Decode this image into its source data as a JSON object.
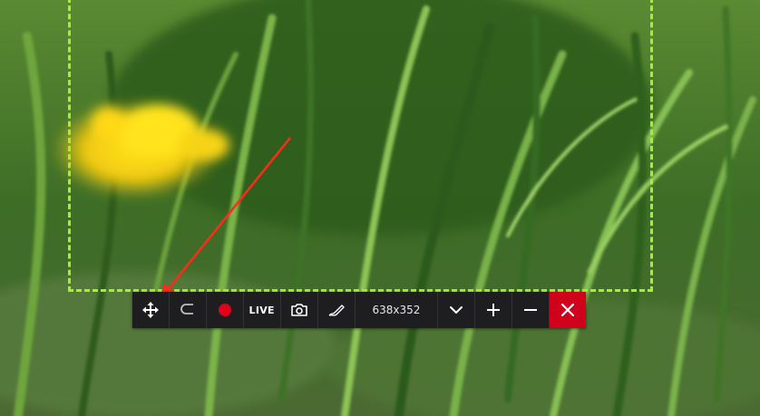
{
  "toolbar": {
    "live_label": "LIVE",
    "size_label": "638x352"
  },
  "icons": {
    "move": "move-icon",
    "lasso": "lasso-icon",
    "record": "record-icon",
    "camera": "camera-icon",
    "pen": "pen-icon",
    "chevron": "chevron-down-icon",
    "plus": "plus-icon",
    "minus": "minus-icon",
    "close": "close-icon"
  },
  "colors": {
    "selection_border": "#a8ee2a",
    "toolbar_bg": "#1e1e20",
    "record": "#e0001b",
    "close_bg": "#d0021b",
    "annotation_arrow": "#ff2a1a"
  }
}
